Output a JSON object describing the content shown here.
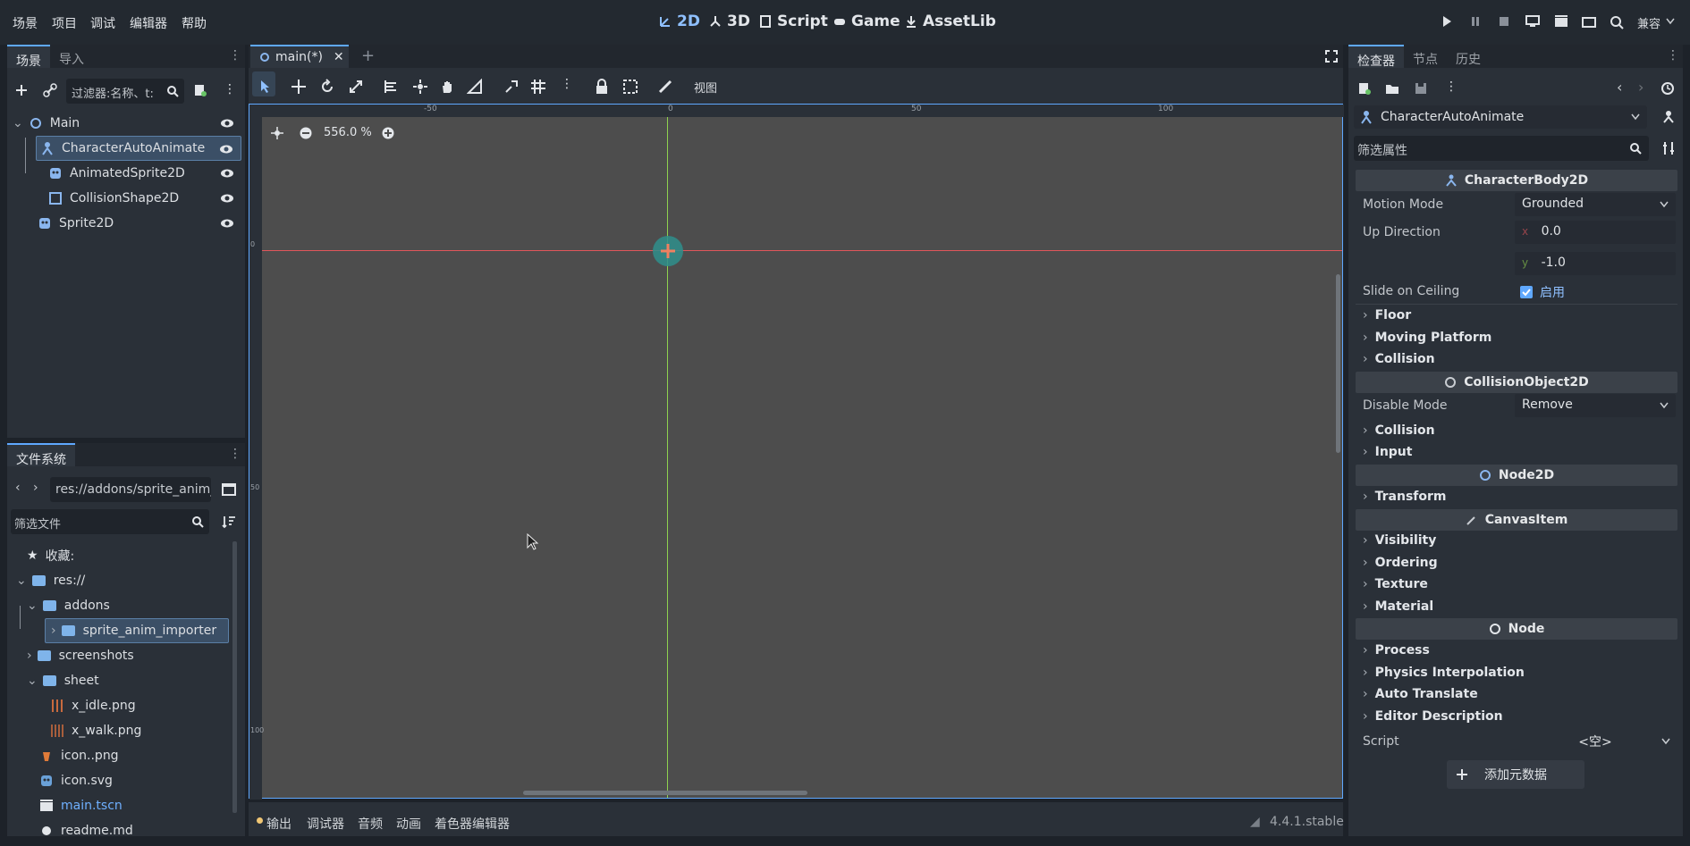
{
  "menu": [
    "场景",
    "项目",
    "调试",
    "编辑器",
    "帮助"
  ],
  "workspaces": [
    {
      "label": "2D",
      "icon": "2d-icon",
      "active": true
    },
    {
      "label": "3D",
      "icon": "3d-icon",
      "active": false
    },
    {
      "label": "Script",
      "icon": "script-icon",
      "active": false
    },
    {
      "label": "Game",
      "icon": "game-icon",
      "active": false
    },
    {
      "label": "AssetLib",
      "icon": "assetlib-icon",
      "active": false
    }
  ],
  "renderer_label": "兼容",
  "scene_dock": {
    "tabs": [
      "场景",
      "导入"
    ],
    "filter_placeholder": "过滤器:名称、t:",
    "nodes": [
      {
        "label": "Main",
        "icon": "node2d-icon",
        "depth": 0,
        "selected": false
      },
      {
        "label": "CharacterAutoAnimate",
        "icon": "character-body-icon",
        "depth": 1,
        "selected": true
      },
      {
        "label": "AnimatedSprite2D",
        "icon": "animated-sprite-icon",
        "depth": 2,
        "selected": false
      },
      {
        "label": "CollisionShape2D",
        "icon": "collision-shape-icon",
        "depth": 2,
        "selected": false
      },
      {
        "label": "Sprite2D",
        "icon": "sprite-icon",
        "depth": 1,
        "selected": false
      }
    ]
  },
  "filesystem_dock": {
    "title": "文件系统",
    "path": "res://addons/sprite_anim_",
    "filter_placeholder": "筛选文件",
    "items": [
      {
        "label": "收藏:",
        "icon": "star-icon"
      },
      {
        "label": "res://",
        "icon": "folder-icon"
      },
      {
        "label": "addons",
        "icon": "folder-icon"
      },
      {
        "label": "sprite_anim_importer",
        "icon": "folder-icon",
        "selected": true
      },
      {
        "label": "screenshots",
        "icon": "folder-icon"
      },
      {
        "label": "sheet",
        "icon": "folder-icon"
      },
      {
        "label": "x_idle.png",
        "icon": "spritesheet-icon"
      },
      {
        "label": "x_walk.png",
        "icon": "spritesheet-icon"
      },
      {
        "label": "icon..png",
        "icon": "png-icon"
      },
      {
        "label": "icon.svg",
        "icon": "svg-icon"
      },
      {
        "label": "main.tscn",
        "icon": "scene-icon",
        "highlight": true
      },
      {
        "label": "readme.md",
        "icon": "text-icon"
      }
    ]
  },
  "editor": {
    "tab_label": "main(*)",
    "view_label": "视图",
    "zoom_label": "556.0 %",
    "ruler_labels": [
      "-50",
      "0",
      "50",
      "100"
    ],
    "vruler_labels": [
      "0",
      "50",
      "100"
    ]
  },
  "bottom_panel": {
    "tabs": [
      "输出",
      "调试器",
      "音频",
      "动画",
      "着色器编辑器"
    ],
    "version": "4.4.1.stable"
  },
  "inspector": {
    "tabs": [
      "检查器",
      "节点",
      "历史"
    ],
    "object_name": "CharacterAutoAnimate",
    "filter_placeholder": "筛选属性",
    "class_characterbody": "CharacterBody2D",
    "motion_mode_label": "Motion Mode",
    "motion_mode_value": "Grounded",
    "up_direction_label": "Up Direction",
    "up_x": "0.0",
    "up_y": "-1.0",
    "slide_label": "Slide on Ceiling",
    "slide_value": "启用",
    "sec_floor": "Floor",
    "sec_moving": "Moving Platform",
    "sec_collision1": "Collision",
    "class_collisionobject": "CollisionObject2D",
    "disable_mode_label": "Disable Mode",
    "disable_mode_value": "Remove",
    "sec_collision2": "Collision",
    "sec_input": "Input",
    "class_node2d": "Node2D",
    "sec_transform": "Transform",
    "class_canvasitem": "CanvasItem",
    "sec_visibility": "Visibility",
    "sec_ordering": "Ordering",
    "sec_texture": "Texture",
    "sec_material": "Material",
    "class_node": "Node",
    "sec_process": "Process",
    "sec_physics": "Physics Interpolation",
    "sec_autotranslate": "Auto Translate",
    "sec_editordesc": "Editor Description",
    "script_label": "Script",
    "script_value": "<空>",
    "add_metadata": "添加元数据"
  },
  "colors": {
    "accent": "#5fa8ff",
    "viewport": "#4d4d4d",
    "x_axis": "#e0565b",
    "y_axis": "#8fd14f"
  }
}
